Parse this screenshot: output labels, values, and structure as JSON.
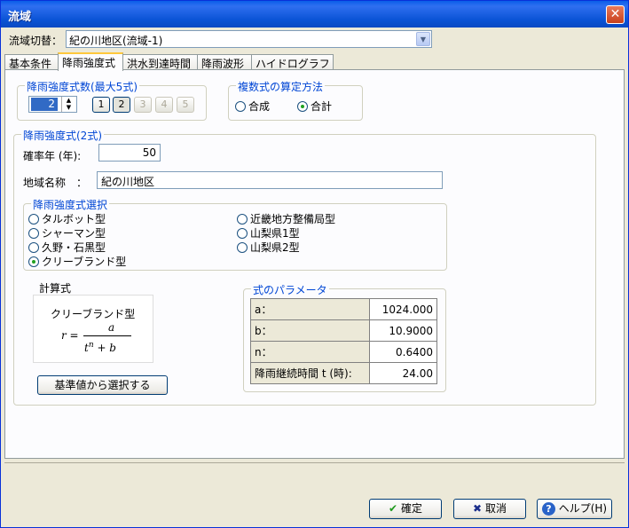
{
  "window": {
    "title": "流域",
    "close_glyph": "✕"
  },
  "basin_select": {
    "label": "流域切替：",
    "value": "紀の川地区(流域-1)"
  },
  "tabs": [
    {
      "label": "基本条件",
      "active": false
    },
    {
      "label": "降雨強度式",
      "active": true
    },
    {
      "label": "洪水到達時間",
      "active": false
    },
    {
      "label": "降雨波形",
      "active": false
    },
    {
      "label": "ハイドログラフ",
      "active": false
    }
  ],
  "count_group": {
    "legend": "降雨強度式数(最大5式)",
    "spin_value": "2",
    "buttons": [
      "1",
      "2",
      "3",
      "4",
      "5"
    ]
  },
  "method_group": {
    "legend": "複数式の算定方法",
    "options": [
      {
        "label": "合成",
        "checked": false
      },
      {
        "label": "合計",
        "checked": true
      }
    ]
  },
  "formula_group": {
    "legend": "降雨強度式(2式)",
    "return_period_label": "確率年 (年):",
    "return_period_value": "50",
    "region_label": "地域名称　：",
    "region_value": "紀の川地区"
  },
  "selection_group": {
    "legend": "降雨強度式選択",
    "left_options": [
      {
        "label": "タルボット型",
        "checked": false
      },
      {
        "label": "シャーマン型",
        "checked": false
      },
      {
        "label": "久野・石黒型",
        "checked": false
      },
      {
        "label": "クリーブランド型",
        "checked": true
      }
    ],
    "right_options": [
      {
        "label": "近畿地方整備局型",
        "checked": false
      },
      {
        "label": "山梨県1型",
        "checked": false
      },
      {
        "label": "山梨県2型",
        "checked": false
      }
    ]
  },
  "calc": {
    "label": "計算式",
    "formula_name": "クリーブランド型",
    "lhs": "r =",
    "numerator": "a",
    "denominator_base": "t",
    "denominator_exp": "n",
    "denominator_rest": " + b"
  },
  "select_button": {
    "label": "基準値から選択する"
  },
  "params_group": {
    "legend": "式のパラメータ",
    "rows": [
      {
        "key": "a：",
        "value": "1024.000"
      },
      {
        "key": "b：",
        "value": "10.9000"
      },
      {
        "key": "n：",
        "value": "0.6400"
      },
      {
        "key": "降雨継続時間 t (時):",
        "value": "24.00"
      }
    ]
  },
  "footer": {
    "ok_label": "確定",
    "cancel_label": "取消",
    "help_label": "ヘルプ(H)"
  },
  "colors": {
    "title_bar": "#0a5ee8",
    "accent": "#0046d5",
    "ok_icon": "#1e9a1e",
    "cancel_icon": "#1c2f8c"
  }
}
